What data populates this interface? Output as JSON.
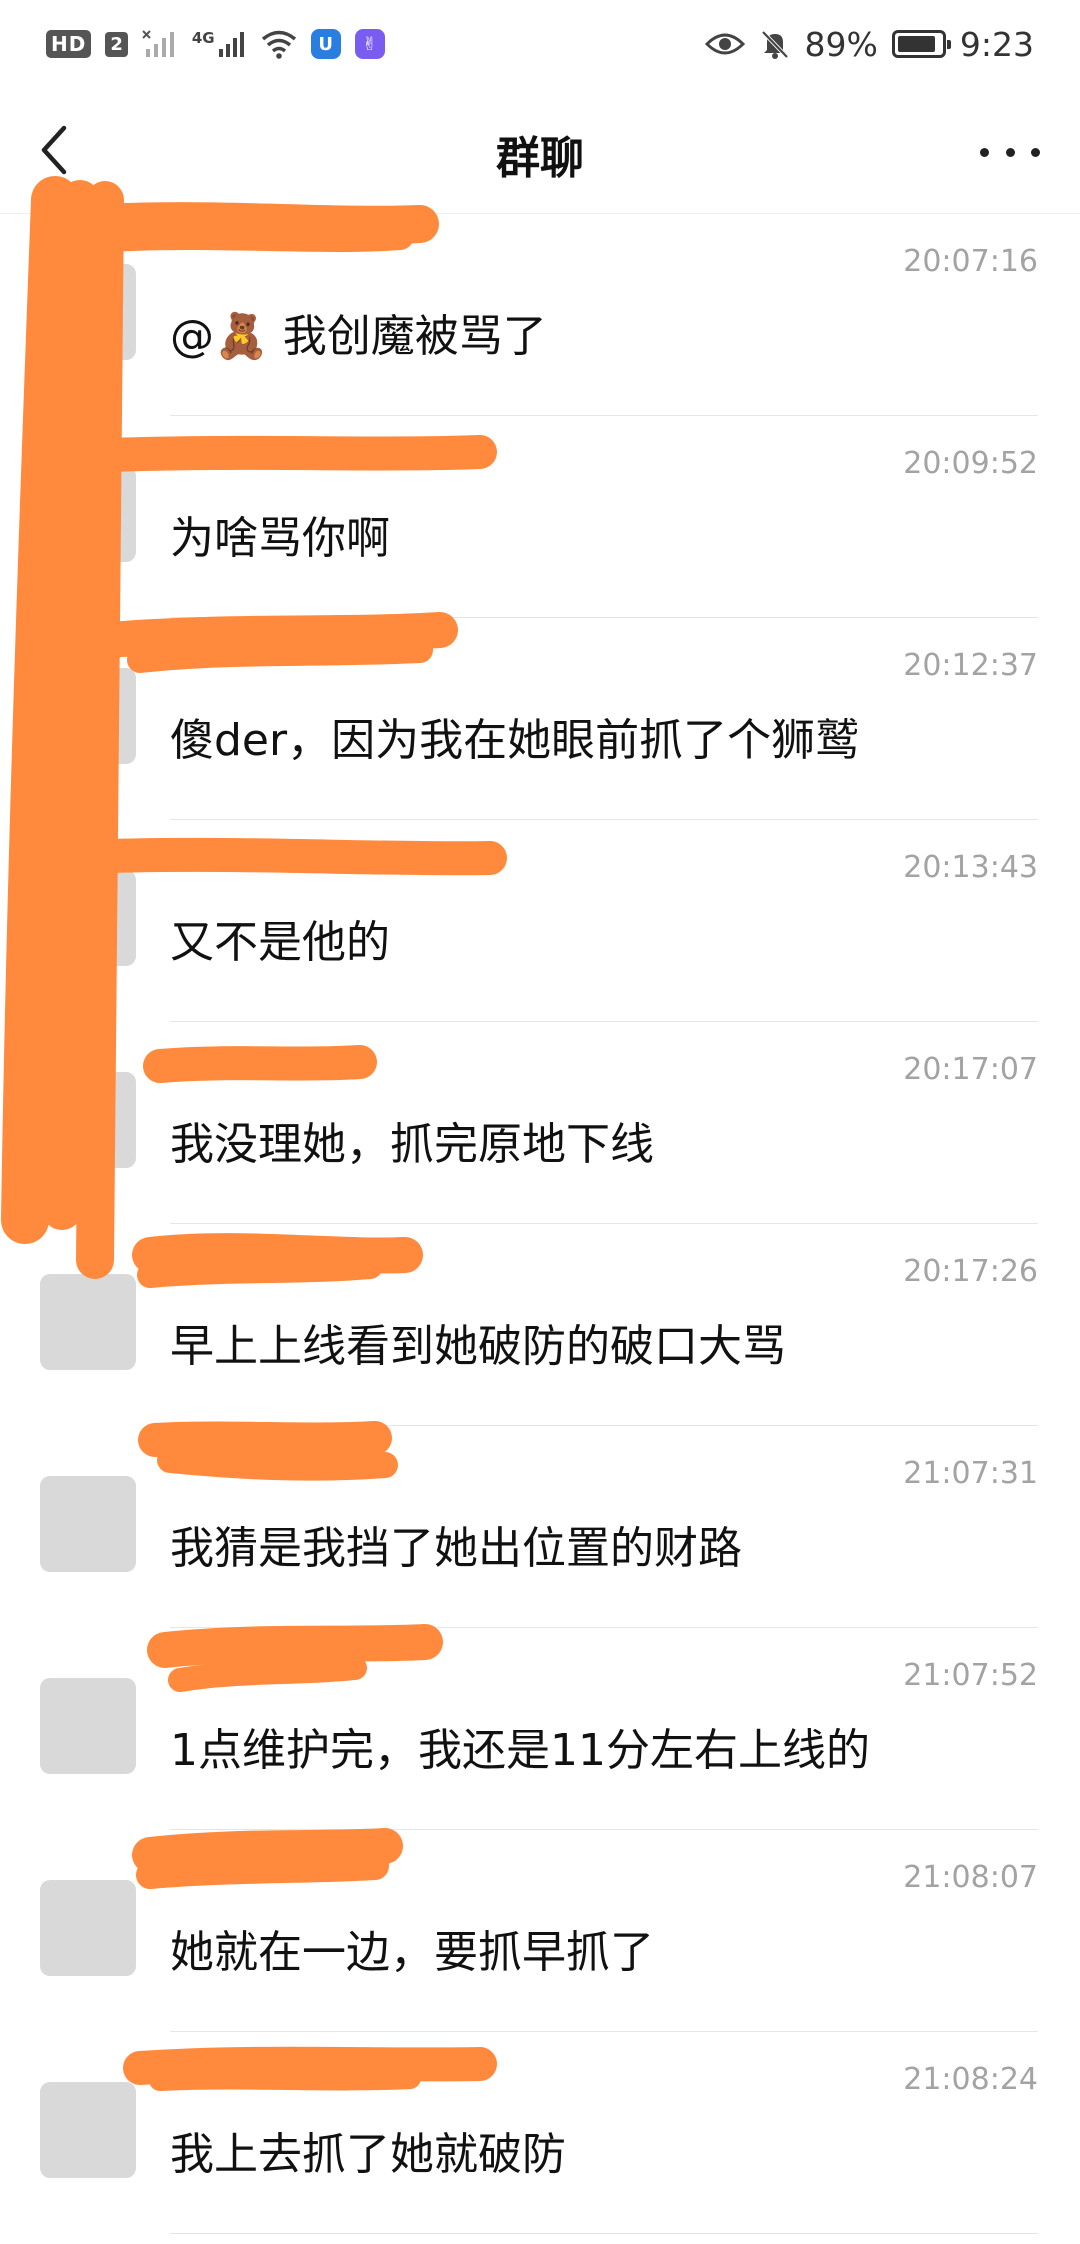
{
  "status_bar": {
    "hd": "HD",
    "sim": "2",
    "network": "4G",
    "battery_percent": "89%",
    "battery_level": 0.89,
    "time": "9:23",
    "icons": [
      "hd-icon",
      "no-signal-icon",
      "signal-4g-icon",
      "wifi-icon",
      "app-notification-icon",
      "app-notification-icon",
      "eye-icon",
      "mute-bell-icon",
      "battery-icon"
    ]
  },
  "header": {
    "title": "群聊",
    "back_icon": "chevron-left-icon",
    "more_icon": "more-dots-icon"
  },
  "messages": [
    {
      "time": "20:07:16",
      "text": "@🧸 我创魔被骂了"
    },
    {
      "time": "20:09:52",
      "text": "为啥骂你啊"
    },
    {
      "time": "20:12:37",
      "text": "傻der，因为我在她眼前抓了个狮鹫"
    },
    {
      "time": "20:13:43",
      "text": "又不是他的"
    },
    {
      "time": "20:17:07",
      "text": "我没理她，抓完原地下线"
    },
    {
      "time": "20:17:26",
      "text": "早上上线看到她破防的破口大骂"
    },
    {
      "time": "21:07:31",
      "text": "我猜是我挡了她出位置的财路"
    },
    {
      "time": "21:07:52",
      "text": "1点维护完，我还是11分左右上线的"
    },
    {
      "time": "21:08:07",
      "text": "她就在一边，要抓早抓了"
    },
    {
      "time": "21:08:24",
      "text": "我上去抓了她就破防"
    }
  ],
  "colors": {
    "redaction": "#FF8A3D",
    "time_text": "#A3A3A3",
    "divider": "#E6E6E6"
  }
}
